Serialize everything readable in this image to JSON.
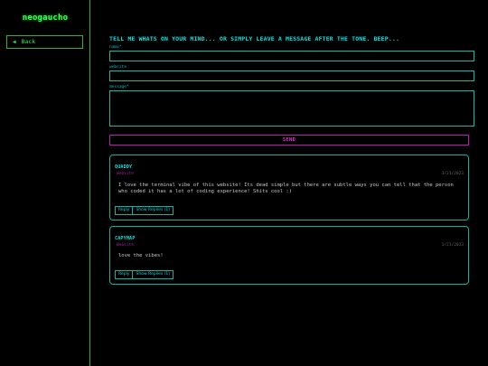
{
  "sidebar": {
    "logo": "neogaucho",
    "back_arrow": "◀",
    "back_label": "Back"
  },
  "form": {
    "heading": "TELL ME WHATS ON YOUR MIND... OR SIMPLY LEAVE A MESSAGE AFTER THE TONE. BEEP...",
    "name_label": "name*",
    "website_label": "website",
    "message_label": "message*",
    "send_label": "SEND"
  },
  "comments": [
    {
      "author": "QUADDY",
      "website": "Website",
      "date": "3/21/2023",
      "body": "I love the terminal vibe of this website! Its dead simple but there are subtle ways you can tell that the person who coded it has a lot of coding experience! Shits cool :)",
      "reply_label": "Reply",
      "show_replies_label": "Show Replies (1)"
    },
    {
      "author": "CAPYMAP",
      "website": "Website",
      "date": "1/21/2023",
      "body": "love the vibes!",
      "reply_label": "Reply",
      "show_replies_label": "Show Replies (1)"
    }
  ],
  "colors": {
    "background": "#000000",
    "green_accent": "#3cff5a",
    "cyan_accent": "#10e0e0",
    "magenta_accent": "#e030d0"
  }
}
